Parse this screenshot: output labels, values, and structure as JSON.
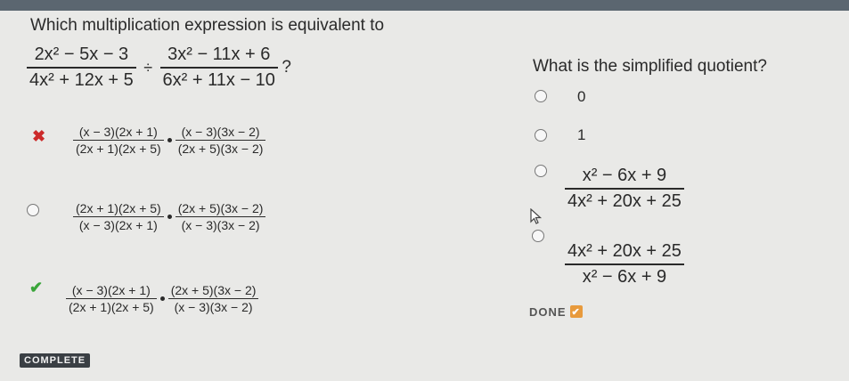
{
  "left_question": {
    "prompt": "Which multiplication expression is equivalent to",
    "expr": {
      "a_num": "2x² − 5x − 3",
      "a_den": "4x² + 12x + 5",
      "op": "÷",
      "b_num": "3x² − 11x + 6",
      "b_den": "6x² + 11x − 10",
      "end": "?"
    },
    "options": [
      {
        "mark": "incorrect",
        "f1_num": "(x − 3)(2x + 1)",
        "f1_den": "(2x + 1)(2x + 5)",
        "f2_num": "(x − 3)(3x − 2)",
        "f2_den": "(2x + 5)(3x − 2)"
      },
      {
        "mark": "none",
        "f1_num": "(2x + 1)(2x + 5)",
        "f1_den": "(x − 3)(2x + 1)",
        "f2_num": "(2x + 5)(3x − 2)",
        "f2_den": "(x − 3)(3x − 2)"
      },
      {
        "mark": "correct",
        "f1_num": "(x − 3)(2x + 1)",
        "f1_den": "(2x + 1)(2x + 5)",
        "f2_num": "(2x + 5)(3x − 2)",
        "f2_den": "(x − 3)(3x − 2)"
      }
    ],
    "complete_label": "COMPLETE"
  },
  "right_question": {
    "prompt": "What is the simplified quotient?",
    "options": [
      {
        "label": "0"
      },
      {
        "label": "1"
      },
      {
        "num": "x² − 6x + 9",
        "den": "4x² + 20x + 25"
      },
      {
        "num": "4x² + 20x + 25",
        "den": "x² − 6x + 9"
      }
    ],
    "done_label": "DONE"
  },
  "colors": {
    "incorrect": "#cc2a2a",
    "correct": "#3aa53a",
    "done_check": "#e89a3c",
    "complete_bg": "#3a3f44"
  },
  "icons": [
    "x-mark-icon",
    "check-mark-icon",
    "radio-icon",
    "mouse-pointer-icon"
  ]
}
